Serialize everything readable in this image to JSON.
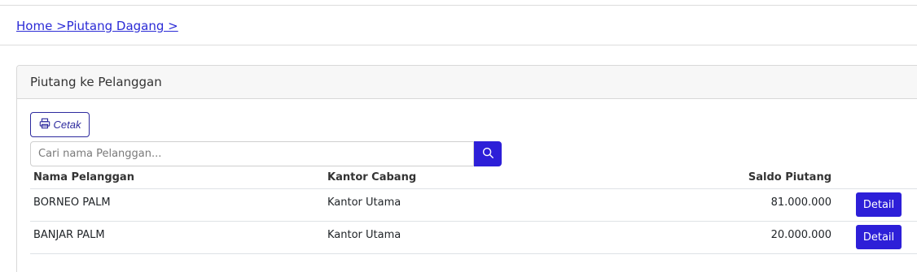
{
  "breadcrumb": {
    "home": "Home >",
    "current": "Piutang Dagang >"
  },
  "card": {
    "title": "Piutang ke Pelanggan",
    "print_label": "Cetak",
    "search_placeholder": "Cari nama Pelanggan..."
  },
  "table": {
    "headers": {
      "nama": "Nama Pelanggan",
      "kantor": "Kantor Cabang",
      "saldo": "Saldo Piutang"
    },
    "rows": [
      {
        "nama": "BORNEO PALM",
        "kantor": "Kantor Utama",
        "saldo": "81.000.000",
        "action": "Detail"
      },
      {
        "nama": "BANJAR PALM",
        "kantor": "Kantor Utama",
        "saldo": "20.000.000",
        "action": "Detail"
      }
    ]
  },
  "icons": {
    "print": "printer-icon",
    "search": "search-icon"
  },
  "colors": {
    "primary": "#2d1fd8",
    "link": "#2b2bd6"
  }
}
